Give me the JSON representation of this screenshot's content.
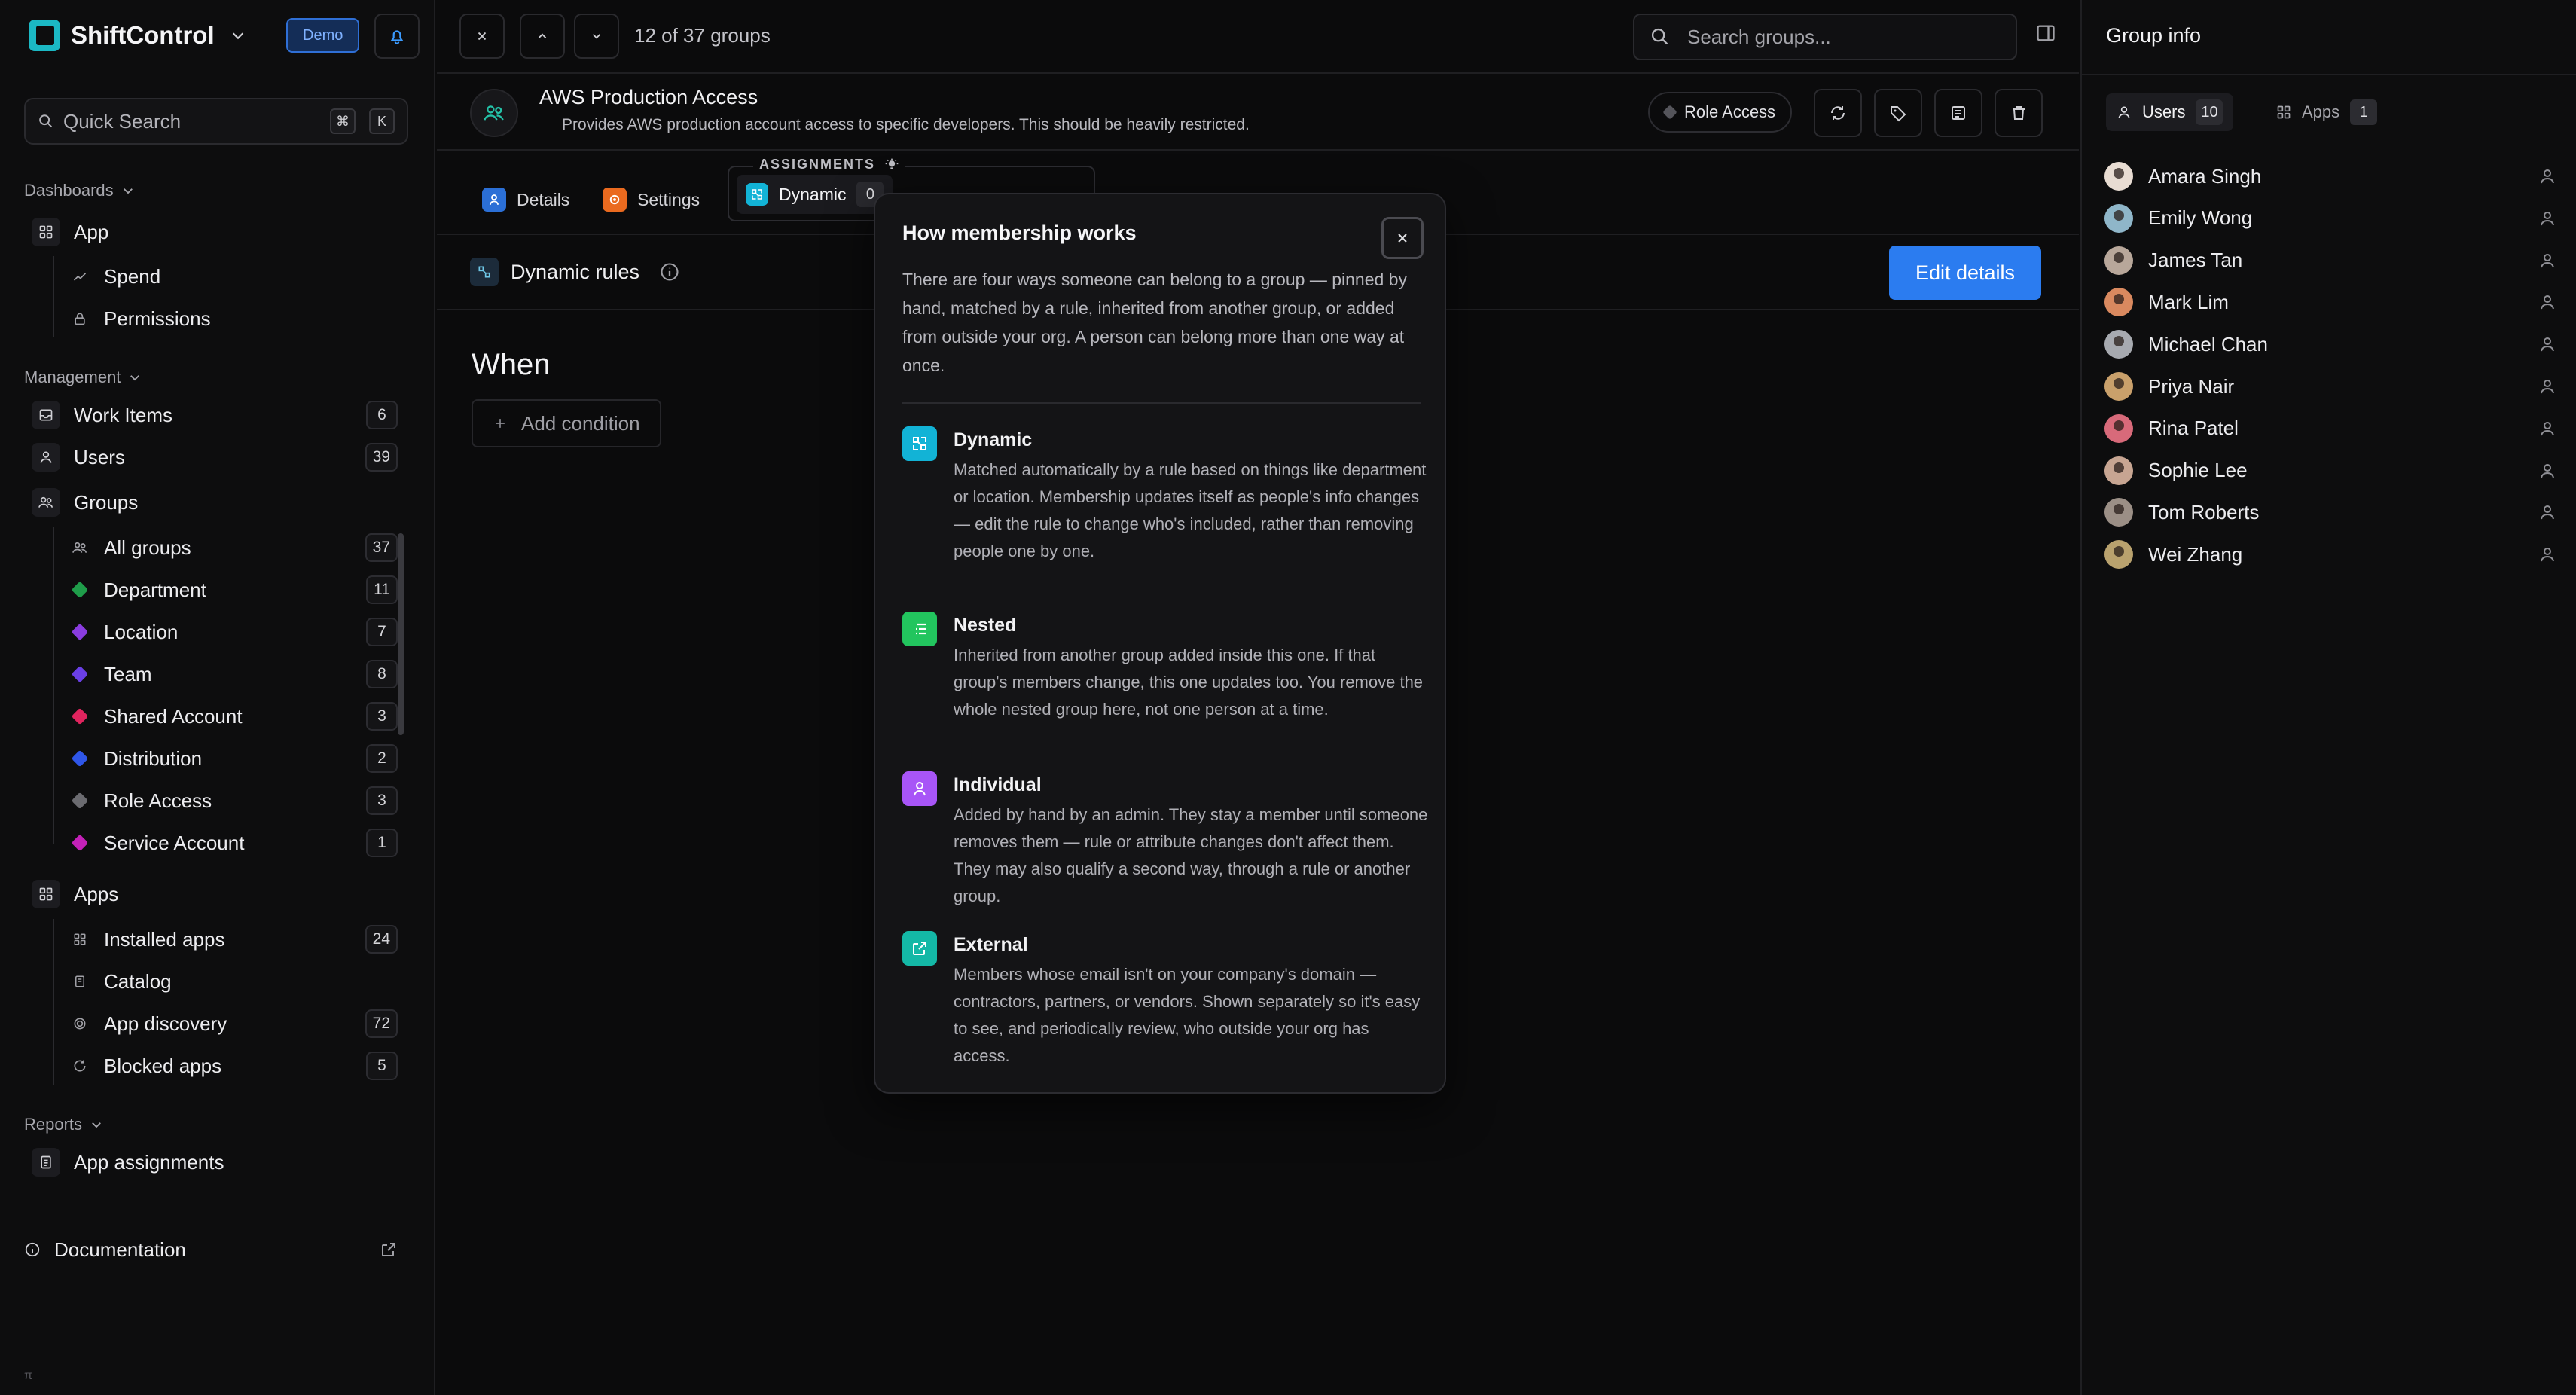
{
  "brand": {
    "name": "ShiftControl",
    "badge": "Demo",
    "accent": "#1bb8c4"
  },
  "quick_search": {
    "label": "Quick Search",
    "shortcut_mod": "⌘",
    "shortcut_key": "K"
  },
  "sidebar": {
    "dashboards": {
      "label": "Dashboards",
      "app": "App",
      "items": [
        {
          "label": "Spend"
        },
        {
          "label": "Permissions"
        }
      ]
    },
    "management": {
      "label": "Management",
      "work_items": {
        "label": "Work Items",
        "count": "6"
      },
      "users": {
        "label": "Users",
        "count": "39"
      },
      "groups": {
        "label": "Groups"
      },
      "group_items": [
        {
          "label": "All groups",
          "count": "37",
          "color": "#9a9aa0"
        },
        {
          "label": "Department",
          "count": "11",
          "color": "#1f9d4a"
        },
        {
          "label": "Location",
          "count": "7",
          "color": "#8a3ce0"
        },
        {
          "label": "Team",
          "count": "8",
          "color": "#6a3fe6"
        },
        {
          "label": "Shared Account",
          "count": "3",
          "color": "#e0245e"
        },
        {
          "label": "Distribution",
          "count": "2",
          "color": "#2f56e8"
        },
        {
          "label": "Role Access",
          "count": "3",
          "color": "#6b6b70"
        },
        {
          "label": "Service Account",
          "count": "1",
          "color": "#c421b8"
        }
      ],
      "apps": {
        "label": "Apps"
      },
      "app_items": [
        {
          "label": "Installed apps",
          "count": "24"
        },
        {
          "label": "Catalog",
          "count": ""
        },
        {
          "label": "App discovery",
          "count": "72"
        },
        {
          "label": "Blocked apps",
          "count": "5"
        }
      ]
    },
    "reports": {
      "label": "Reports",
      "items": [
        {
          "label": "App assignments"
        }
      ]
    },
    "documentation": "Documentation",
    "footer_glyph": "π"
  },
  "topbar": {
    "group_count": "12 of 37 groups",
    "search_placeholder": "Search groups..."
  },
  "group": {
    "title": "AWS Production Access",
    "description": "Provides AWS production account access to specific developers. This should be heavily restricted.",
    "type_pill": "Role Access"
  },
  "tabs": {
    "details": "Details",
    "settings": "Settings",
    "assignments_label": "ASSIGNMENTS",
    "dynamic": {
      "label": "Dynamic",
      "count": "0"
    }
  },
  "content": {
    "rules_title": "Dynamic rules",
    "edit_button": "Edit details",
    "when": "When",
    "add_condition": "Add condition"
  },
  "popover": {
    "title": "How membership works",
    "intro": "There are four ways someone can belong to a group — pinned by hand, matched by a rule, inherited from another group, or added from outside your org. A person can belong more than one way at once.",
    "ways": [
      {
        "title": "Dynamic",
        "color": "#12b3d6",
        "icon": "dynamic-icon",
        "text": "Matched automatically by a rule based on things like department or location. Membership updates itself as people's info changes — edit the rule to change who's included, rather than removing people one by one."
      },
      {
        "title": "Nested",
        "color": "#22c55e",
        "icon": "list-icon",
        "text": "Inherited from another group added inside this one. If that group's members change, this one updates too. You remove the whole nested group here, not one person at a time."
      },
      {
        "title": "Individual",
        "color": "#a855f7",
        "icon": "person-icon",
        "text": "Added by hand by an admin. They stay a member until someone removes them — rule or attribute changes don't affect them. They may also qualify a second way, through a rule or another group."
      },
      {
        "title": "External",
        "color": "#14b8a6",
        "icon": "external-link-icon",
        "text": "Members whose email isn't on your company's domain — contractors, partners, or vendors. Shown separately so it's easy to see, and periodically review, who outside your org has access."
      }
    ]
  },
  "right_panel": {
    "title": "Group info",
    "tabs": [
      {
        "label": "Users",
        "count": "10"
      },
      {
        "label": "Apps",
        "count": "1"
      }
    ],
    "users": [
      {
        "name": "Amara Singh",
        "avatar": "#e8dcd2"
      },
      {
        "name": "Emily Wong",
        "avatar": "#8fb6c9"
      },
      {
        "name": "James Tan",
        "avatar": "#b8a79a"
      },
      {
        "name": "Mark Lim",
        "avatar": "#d9895f"
      },
      {
        "name": "Michael Chan",
        "avatar": "#a7aab0"
      },
      {
        "name": "Priya Nair",
        "avatar": "#c9a06b"
      },
      {
        "name": "Rina Patel",
        "avatar": "#d86a7a"
      },
      {
        "name": "Sophie Lee",
        "avatar": "#c7a592"
      },
      {
        "name": "Tom Roberts",
        "avatar": "#9b8f86"
      },
      {
        "name": "Wei Zhang",
        "avatar": "#b9a26e"
      }
    ]
  }
}
